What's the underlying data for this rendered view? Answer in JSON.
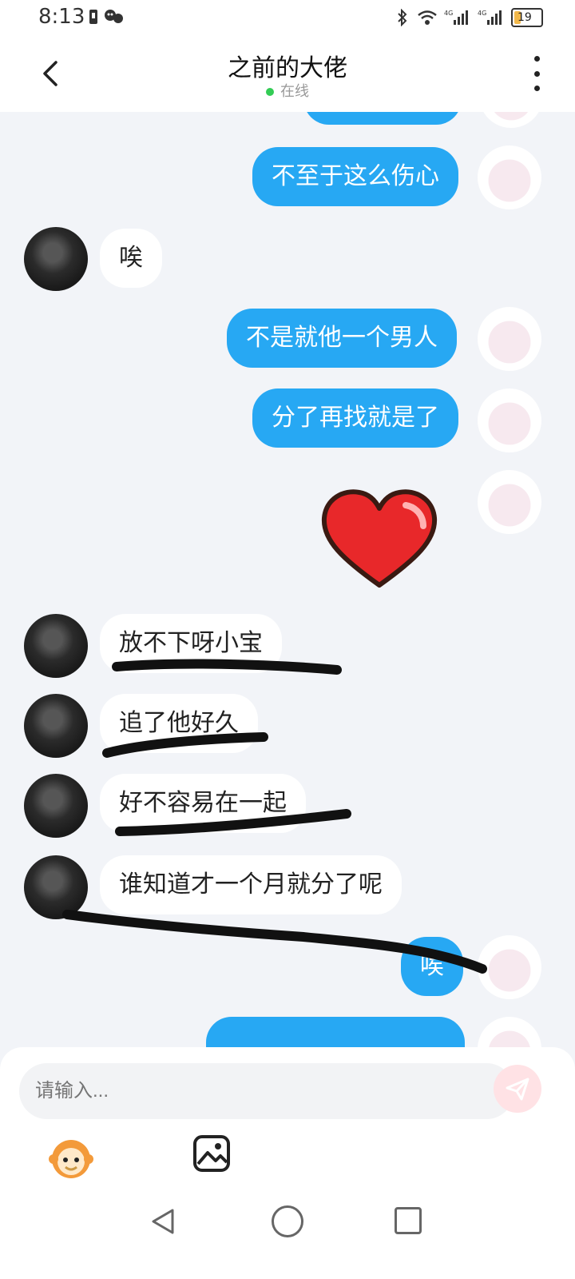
{
  "status_bar": {
    "time": "8:13",
    "battery": "19"
  },
  "header": {
    "title": "之前的大佬",
    "status": "在线"
  },
  "messages": [
    {
      "side": "me",
      "text": ""
    },
    {
      "side": "me",
      "text": "不至于这么伤心"
    },
    {
      "side": "other",
      "text": "唉"
    },
    {
      "side": "me",
      "text": "不是就他一个男人"
    },
    {
      "side": "me",
      "text": "分了再找就是了"
    },
    {
      "side": "me",
      "type": "sticker",
      "icon": "heart-sticker-icon"
    },
    {
      "side": "other",
      "text": "放不下呀小宝"
    },
    {
      "side": "other",
      "text": "追了他好久"
    },
    {
      "side": "other",
      "text": "好不容易在一起"
    },
    {
      "side": "other",
      "text": "谁知道才一个月就分了呢"
    },
    {
      "side": "me",
      "text": "唉"
    },
    {
      "side": "me",
      "text": ""
    }
  ],
  "input": {
    "placeholder": "请输入..."
  },
  "colors": {
    "my_bubble": "#27a8f3",
    "other_bubble": "#ffffff",
    "online_dot": "#33cc55",
    "background": "#f2f4f8"
  }
}
